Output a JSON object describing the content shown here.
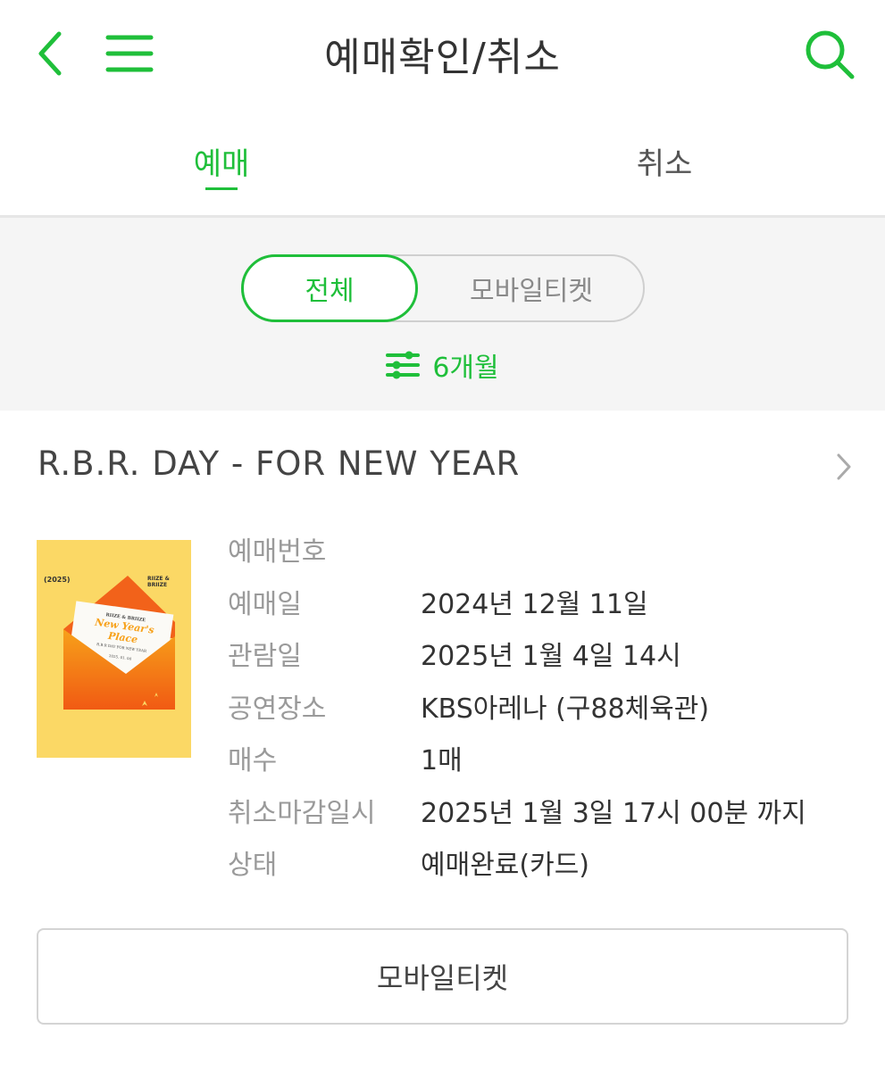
{
  "header": {
    "title": "예매확인/취소",
    "back_icon": "chevron-left-icon",
    "menu_icon": "hamburger-menu-icon",
    "search_icon": "search-icon",
    "accent_color": "#1fbf3a"
  },
  "tabs": [
    {
      "label": "예매",
      "active": true
    },
    {
      "label": "취소",
      "active": false
    }
  ],
  "filter": {
    "segments": [
      {
        "label": "전체",
        "active": true
      },
      {
        "label": "모바일티켓",
        "active": false
      }
    ],
    "period_label": "6개월",
    "period_icon": "sliders-icon"
  },
  "booking": {
    "event_title": "R.B.R. DAY - FOR NEW YEAR",
    "poster": {
      "year_tag": "(2025)",
      "brand": "RIIZE & BRIIZE",
      "headline": "New Year's Place",
      "subtitle": "R.B.R DAY FOR NEW YEAR",
      "date_line": "2025. 01. 04"
    },
    "details": [
      {
        "label": "예매번호",
        "value": ""
      },
      {
        "label": "예매일",
        "value": "2024년 12월 11일"
      },
      {
        "label": "관람일",
        "value": "2025년 1월 4일 14시"
      },
      {
        "label": "공연장소",
        "value": "KBS아레나 (구88체육관)"
      },
      {
        "label": "매수",
        "value": "1매"
      },
      {
        "label": "취소마감일시",
        "value": "2025년 1월 3일 17시 00분 까지"
      },
      {
        "label": "상태",
        "value": "예매완료(카드)"
      }
    ],
    "mobile_ticket_button": "모바일티켓"
  }
}
